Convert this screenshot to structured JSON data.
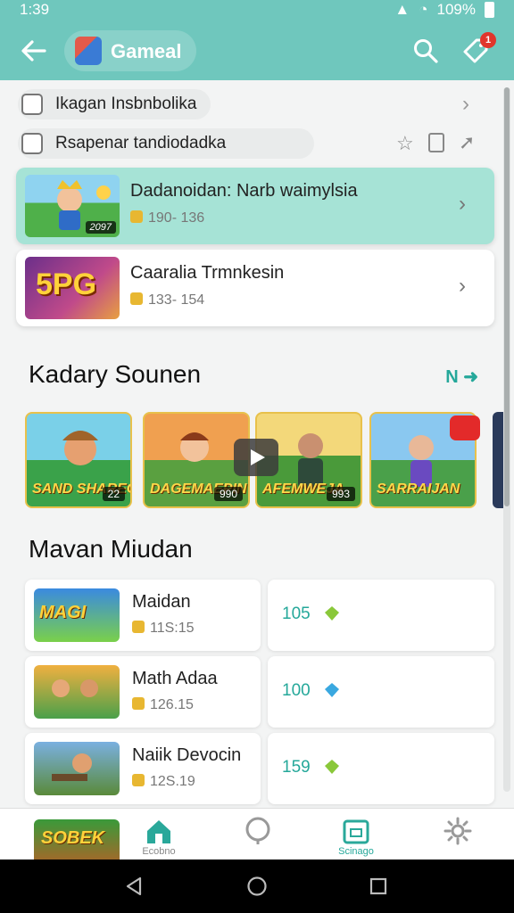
{
  "status": {
    "time": "1:39",
    "battery": "109%"
  },
  "appbar": {
    "title": "Gameal",
    "notification_count": "1"
  },
  "quick_rows": [
    {
      "label": "Ikagan Insbnbolika"
    },
    {
      "label": "Rsapenar tandiodadka"
    }
  ],
  "featured": [
    {
      "title": "Dadanoidan: Narb waimylsia",
      "meta": "190- 136",
      "badge": "2097"
    },
    {
      "title": "Caaralia Trmnkesin",
      "meta": "133- 154",
      "thumb_text": "5PG"
    }
  ],
  "section1": {
    "title": "Kadary Sounen",
    "more_label": "N"
  },
  "tiles": [
    {
      "label": "SAND SHAREGS",
      "badge": "22"
    },
    {
      "label": "DAGEMAEPIN",
      "badge": "990"
    },
    {
      "label": "AFEMWEJA",
      "badge": "993"
    },
    {
      "label": "SARRAIJAN",
      "badge": ""
    }
  ],
  "section2": {
    "title": "Mavan Miudan"
  },
  "list": [
    {
      "name": "Maidan",
      "sub": "11S:15",
      "value": "105",
      "gem": "green"
    },
    {
      "name": "Math Adaa",
      "sub": "126.15",
      "value": "100",
      "gem": "blue"
    },
    {
      "name": "Naiik Devocin",
      "sub": "12S.19",
      "value": "159",
      "gem": "green"
    }
  ],
  "bottom_nav": {
    "home_label": "Ecobno",
    "active_label": "Scinago"
  },
  "colors": {
    "primary": "#6fc7bd",
    "accent": "#25a89a",
    "highlight": "#a6e3d6"
  }
}
